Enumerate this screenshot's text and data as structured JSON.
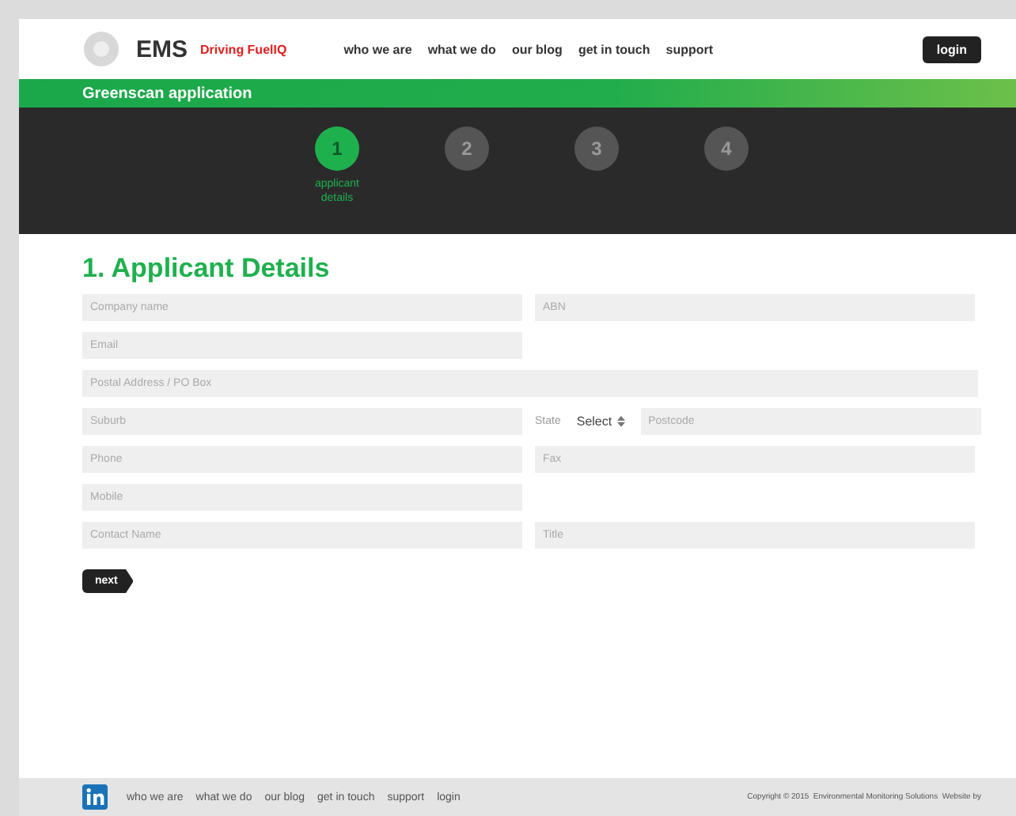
{
  "header": {
    "logo": "EMS",
    "tagline": "Driving FuelIQ",
    "nav": [
      "who we are",
      "what we do",
      "our blog",
      "get in touch",
      "support"
    ],
    "login": "login"
  },
  "banner": {
    "title": "Greenscan application"
  },
  "steps": [
    {
      "number": "1",
      "label": "applicant details",
      "selected": true
    },
    {
      "number": "2",
      "selected": false
    },
    {
      "number": "3",
      "selected": false
    },
    {
      "number": "4",
      "selected": false
    }
  ],
  "form": {
    "heading": "1. Applicant Details",
    "rows": [
      {
        "fields": [
          {
            "kind": "half",
            "placeholder": "Company name"
          },
          {
            "kind": "half",
            "placeholder": "ABN"
          }
        ]
      },
      {
        "fields": [
          {
            "kind": "half",
            "placeholder": "Email"
          }
        ]
      },
      {
        "fields": [
          {
            "kind": "full",
            "placeholder": "Postal Address / PO Box"
          }
        ]
      },
      {
        "fields": [
          {
            "kind": "half",
            "placeholder": "Suburb"
          },
          {
            "kind": "label",
            "text": "State"
          },
          {
            "kind": "select",
            "value": "Select"
          },
          {
            "kind": "grow",
            "placeholder": "Postcode"
          }
        ]
      },
      {
        "fields": [
          {
            "kind": "half",
            "placeholder": "Phone"
          },
          {
            "kind": "half",
            "placeholder": "Fax"
          }
        ]
      },
      {
        "fields": [
          {
            "kind": "half",
            "placeholder": "Mobile"
          }
        ]
      },
      {
        "fields": [
          {
            "kind": "half",
            "placeholder": "Contact Name"
          },
          {
            "kind": "half",
            "placeholder": "Title"
          }
        ]
      }
    ],
    "next": "next"
  },
  "footer": {
    "nav": [
      "who we are",
      "what we do",
      "our blog",
      "get in touch",
      "support",
      "login"
    ],
    "copyright": "Copyright © 2015  Environmental Monitoring Solutions  Website by"
  }
}
